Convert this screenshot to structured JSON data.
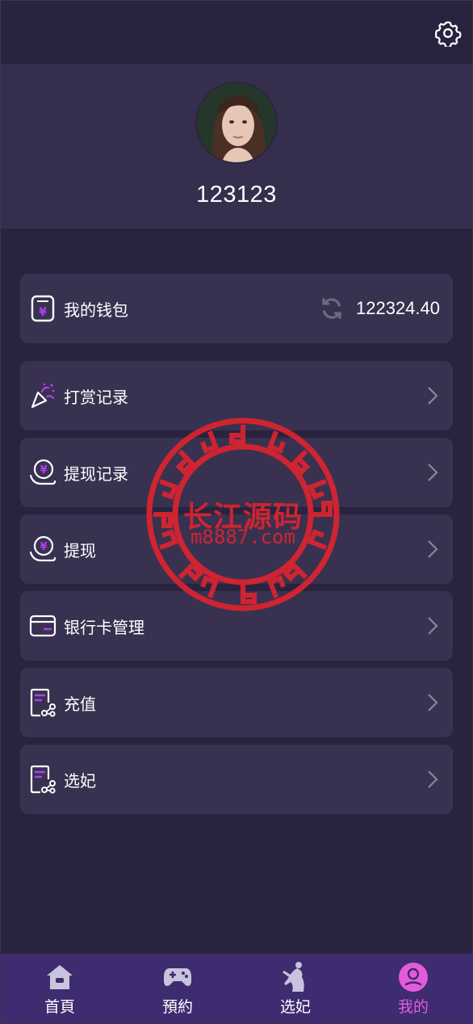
{
  "profile": {
    "username": "123123"
  },
  "wallet": {
    "label": "我的钱包",
    "amount": "122324.40"
  },
  "menu": [
    {
      "label": "打赏记录",
      "icon": "party-popper-icon"
    },
    {
      "label": "提现记录",
      "icon": "yuan-hand-icon"
    },
    {
      "label": "提现",
      "icon": "yuan-hand-icon"
    },
    {
      "label": "银行卡管理",
      "icon": "bank-card-icon"
    },
    {
      "label": "充值",
      "icon": "document-share-icon"
    },
    {
      "label": "选妃",
      "icon": "document-share-icon"
    }
  ],
  "watermark": {
    "title": "长江源码",
    "url": "m8887.com"
  },
  "tabs": [
    {
      "label": "首頁",
      "icon": "home-icon"
    },
    {
      "label": "預約",
      "icon": "gamepad-icon"
    },
    {
      "label": "选妃",
      "icon": "dancer-icon"
    },
    {
      "label": "我的",
      "icon": "user-icon",
      "active": true
    }
  ],
  "colors": {
    "background": "#29233f",
    "card": "#383250",
    "accent": "#e45bd9",
    "tabbar": "#3e2b70",
    "icon_purple": "#b23ef0"
  }
}
